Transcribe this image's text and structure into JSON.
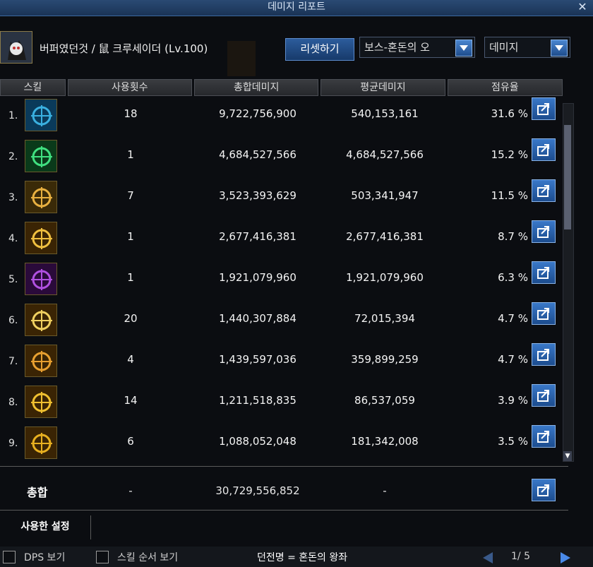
{
  "window": {
    "title": "데미지 리포트",
    "close_label": "✕"
  },
  "character": {
    "name": "버퍼였던것 / 鼠 크루세이더 (Lv.100)"
  },
  "controls": {
    "reset_label": "리셋하기",
    "target_select": "보스-혼돈의 오",
    "metric_select": "데미지"
  },
  "columns": [
    "스킬",
    "사용횟수",
    "총합데미지",
    "평균데미지",
    "점유율"
  ],
  "rows": [
    {
      "rank": "1.",
      "count": "18",
      "total": "9,722,756,900",
      "avg": "540,153,161",
      "share": "31.6 %"
    },
    {
      "rank": "2.",
      "count": "1",
      "total": "4,684,527,566",
      "avg": "4,684,527,566",
      "share": "15.2 %"
    },
    {
      "rank": "3.",
      "count": "7",
      "total": "3,523,393,629",
      "avg": "503,341,947",
      "share": "11.5 %"
    },
    {
      "rank": "4.",
      "count": "1",
      "total": "2,677,416,381",
      "avg": "2,677,416,381",
      "share": "8.7 %"
    },
    {
      "rank": "5.",
      "count": "1",
      "total": "1,921,079,960",
      "avg": "1,921,079,960",
      "share": "6.3 %"
    },
    {
      "rank": "6.",
      "count": "20",
      "total": "1,440,307,884",
      "avg": "72,015,394",
      "share": "4.7 %"
    },
    {
      "rank": "7.",
      "count": "4",
      "total": "1,439,597,036",
      "avg": "359,899,259",
      "share": "4.7 %"
    },
    {
      "rank": "8.",
      "count": "14",
      "total": "1,211,518,835",
      "avg": "86,537,059",
      "share": "3.9 %"
    },
    {
      "rank": "9.",
      "count": "6",
      "total": "1,088,052,048",
      "avg": "181,342,008",
      "share": "3.5 %"
    }
  ],
  "summary": {
    "label": "총합",
    "count": "-",
    "total": "30,729,556,852",
    "avg": "-"
  },
  "settings_tab": "사용한 설정",
  "footer": {
    "dps_label": "DPS 보기",
    "skill_order_label": "스킬 순서 보기",
    "dungeon": "던전명 = 혼돈의 왕좌",
    "page": "1/ 5"
  }
}
